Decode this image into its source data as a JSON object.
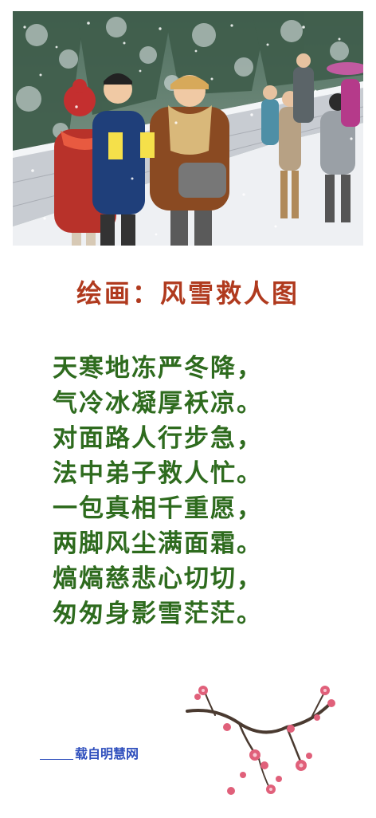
{
  "illustration": {
    "name": "snow-scene-illustration",
    "colors": {
      "sky": "#5c7a6a",
      "snow": "#f3f5f7",
      "wall": "#c8ccd2",
      "coat_red": "#b8322a",
      "coat_blue": "#1f3f7a",
      "coat_brown": "#8a4a22",
      "flyer": "#f5e04a"
    }
  },
  "title": {
    "text": "绘画：风雪救人图",
    "color": "#b03a1e"
  },
  "poem": {
    "color": "#2e6b1e",
    "lines": [
      "天寒地冻严冬降，",
      "气冷冰凝厚袄凉。",
      "对面路人行步急，",
      "法中弟子救人忙。",
      "一包真相千重愿，",
      "两脚风尘满面霜。",
      "熇熇慈悲心切切，",
      "匆匆身影雪茫茫。"
    ]
  },
  "source": {
    "text": "载自明慧网",
    "color": "#2f4fbd"
  },
  "decoration": {
    "name": "plum-blossom-branch",
    "petal_color": "#e0607a",
    "branch_color": "#4a3a30"
  }
}
